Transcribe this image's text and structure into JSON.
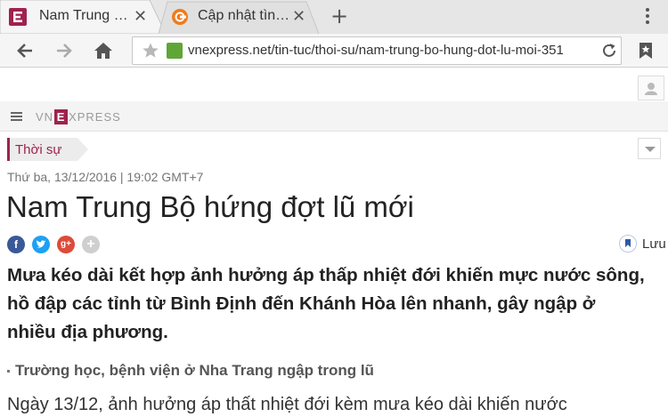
{
  "tabs": [
    {
      "title": "Nam Trung …",
      "favicon": "vnexpress-favicon",
      "close": "✕"
    },
    {
      "title": "Cập nhật tìn…",
      "favicon": "orange-favicon",
      "close": "✕"
    }
  ],
  "new_tab": "+",
  "toolbar": {
    "url": "vnexpress.net/tin-tuc/thoi-su/nam-trung-bo-hung-dot-lu-moi-351"
  },
  "site": {
    "logo_prefix": "VN",
    "logo_letter": "E",
    "logo_suffix": "XPRESS"
  },
  "article": {
    "category": "Thời sự",
    "dateline": "Thứ ba, 13/12/2016 | 19:02 GMT+7",
    "headline": "Nam Trung Bộ hứng đợt lũ mới",
    "share": {
      "facebook": "f",
      "google": "g+",
      "more": "+"
    },
    "save_label": "Lưu",
    "lead": "Mưa kéo dài kết hợp ảnh hưởng áp thấp nhiệt đới khiến mực nước sông, hồ đập các tỉnh từ Bình Định đến Khánh Hòa lên nhanh, gây ngập ở nhiều địa phương.",
    "related": "Trường học, bệnh viện ở Nha Trang ngập trong lũ",
    "body_start": "Ngày 13/12, ảnh hưởng áp thất nhiệt đới kèm mưa kéo dài khiến nước"
  },
  "colors": {
    "brand": "#9f224e",
    "facebook": "#3b5998",
    "twitter": "#1da1f2",
    "google": "#dd4b39"
  }
}
